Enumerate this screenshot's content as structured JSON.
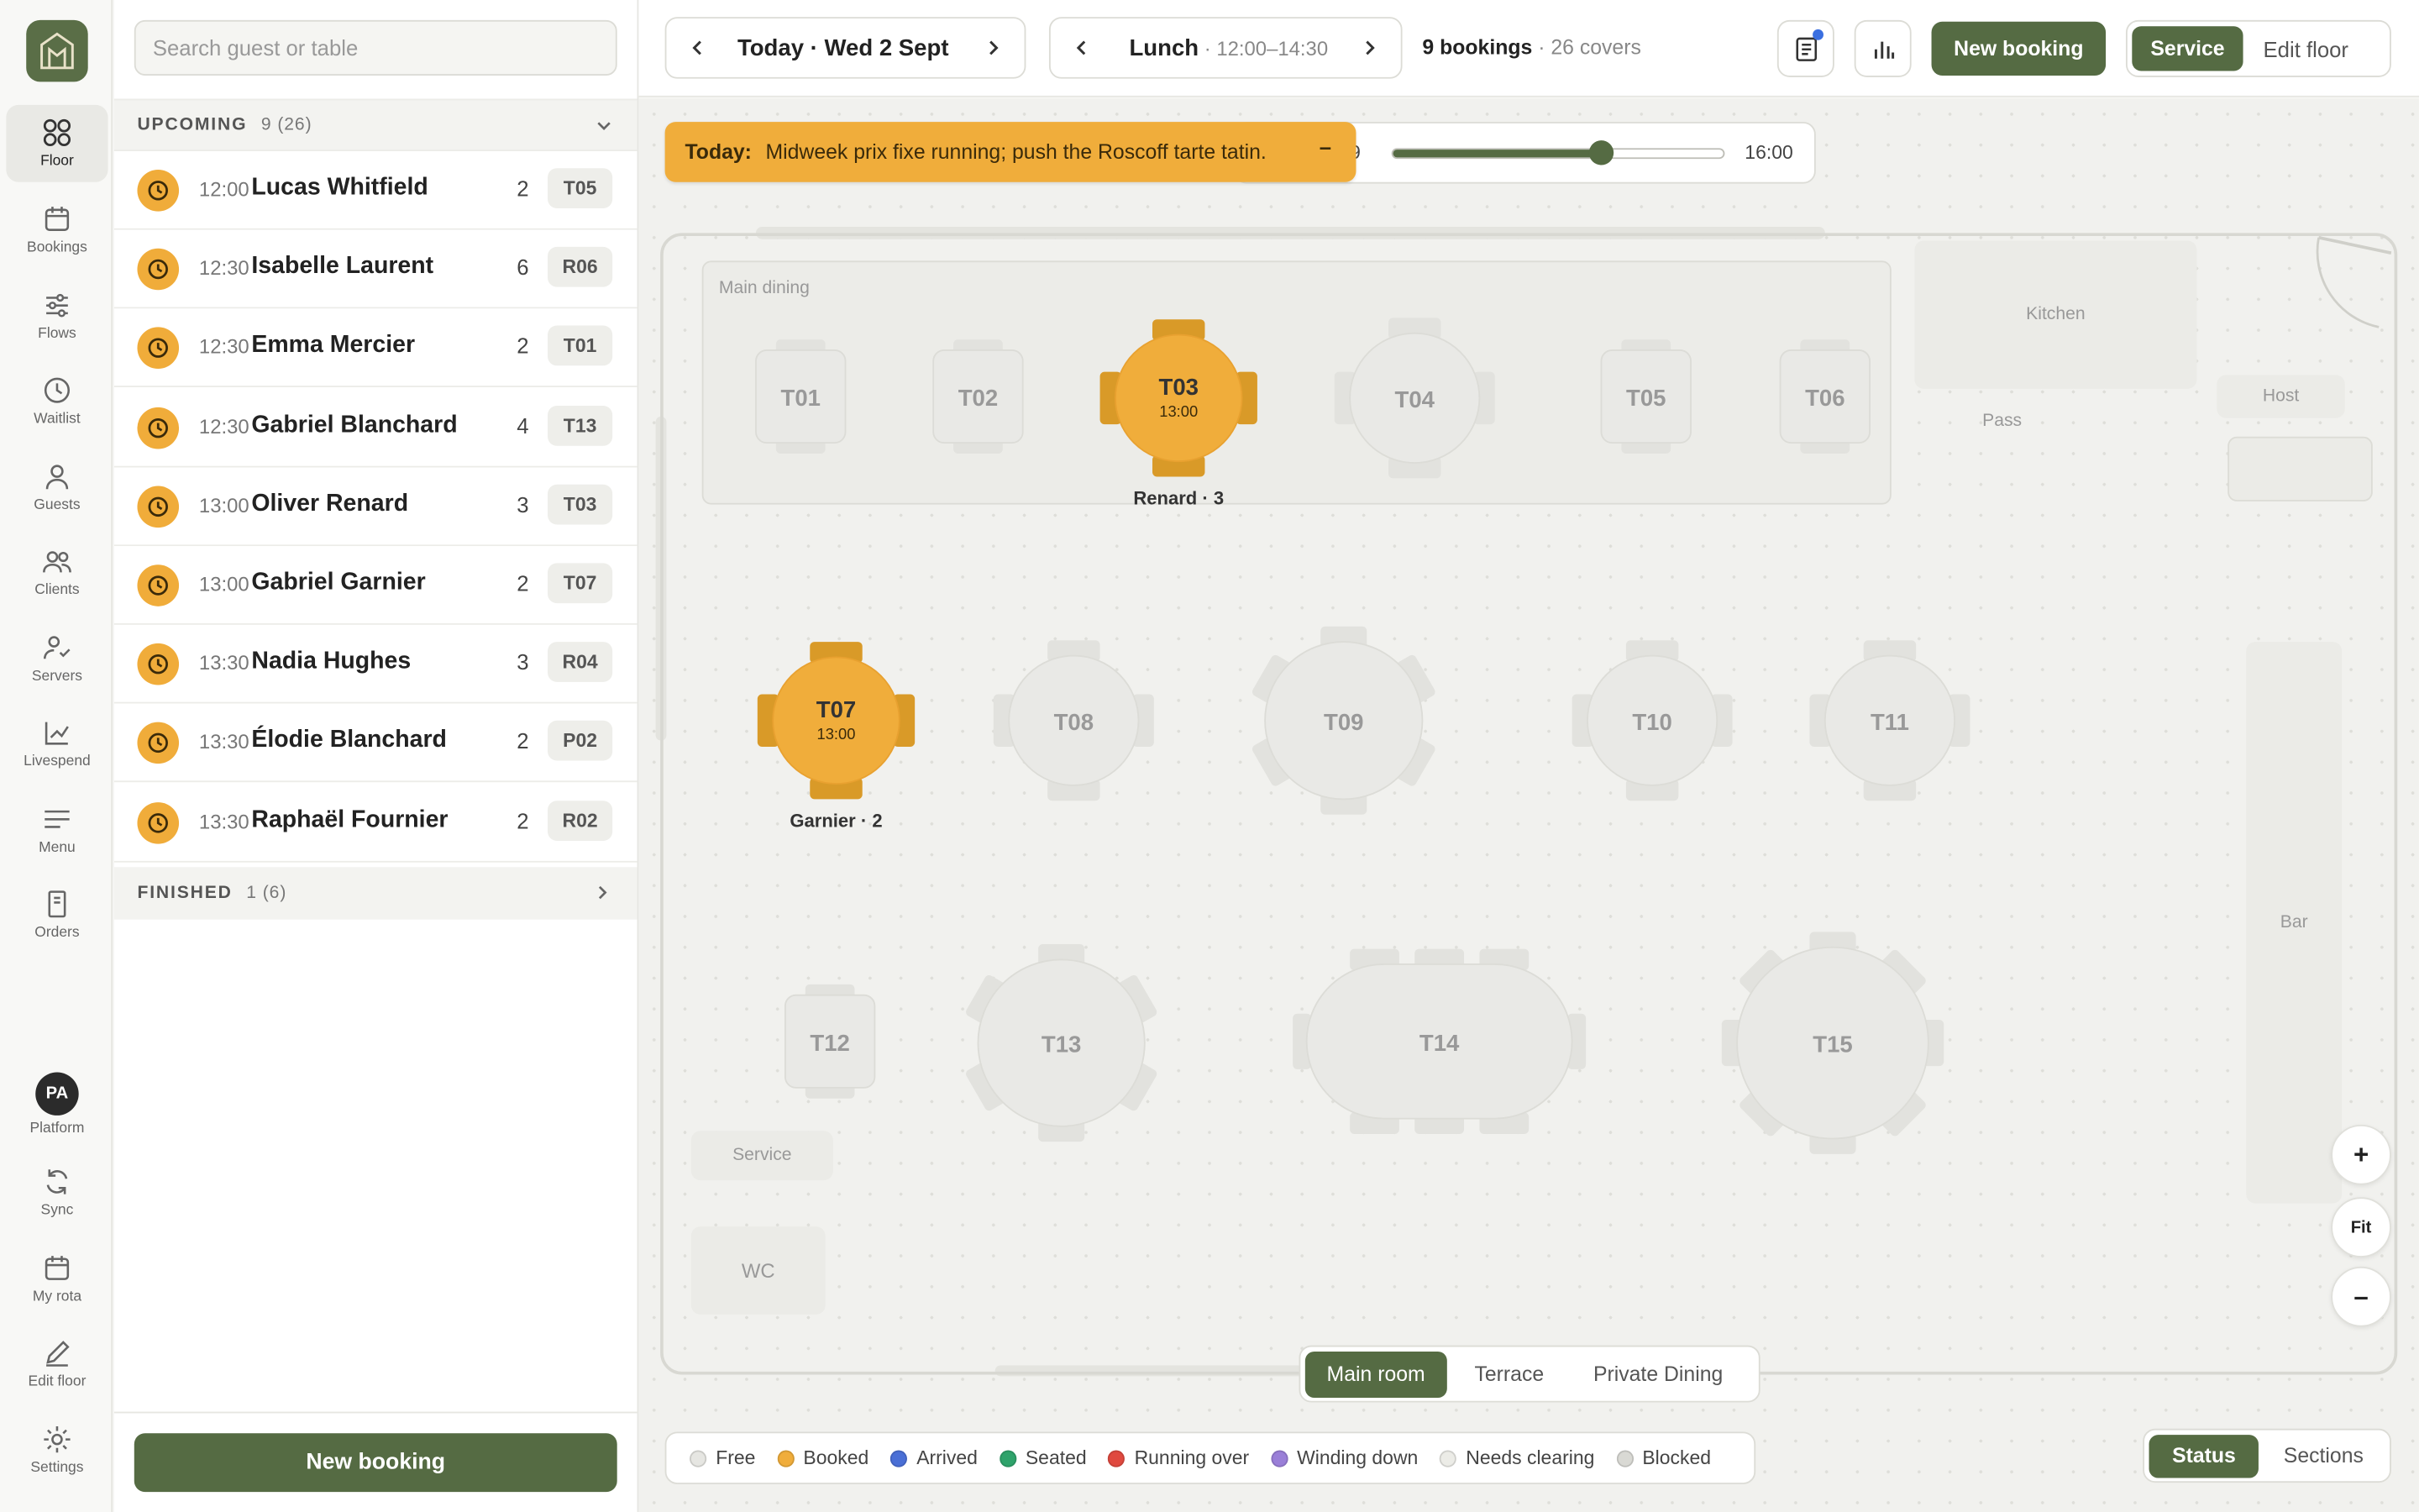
{
  "nav": {
    "items": [
      {
        "label": "Floor",
        "icon": "floor-grid-icon",
        "active": true
      },
      {
        "label": "Bookings",
        "icon": "calendar-icon"
      },
      {
        "label": "Flows",
        "icon": "sliders-icon"
      },
      {
        "label": "Waitlist",
        "icon": "clock-icon"
      },
      {
        "label": "Guests",
        "icon": "person-icon"
      },
      {
        "label": "Clients",
        "icon": "people-icon"
      },
      {
        "label": "Servers",
        "icon": "server-staff-icon"
      },
      {
        "label": "Livespend",
        "icon": "trend-chart-icon"
      },
      {
        "label": "Menu",
        "icon": "menu-lines-icon"
      },
      {
        "label": "Orders",
        "icon": "receipt-icon"
      }
    ],
    "bottom": [
      {
        "label": "Platform",
        "avatar": "PA"
      },
      {
        "label": "Sync",
        "icon": "sync-icon"
      },
      {
        "label": "My rota",
        "icon": "calendar-icon"
      },
      {
        "label": "Edit floor",
        "icon": "pencil-icon"
      },
      {
        "label": "Settings",
        "icon": "gear-icon"
      }
    ]
  },
  "search": {
    "placeholder": "Search guest or table"
  },
  "upcoming": {
    "title": "UPCOMING",
    "count": "9 (26)",
    "rows": [
      {
        "time": "12:00",
        "name": "Lucas Whitfield",
        "covers": "2",
        "table": "T05"
      },
      {
        "time": "12:30",
        "name": "Isabelle Laurent",
        "covers": "6",
        "table": "R06"
      },
      {
        "time": "12:30",
        "name": "Emma Mercier",
        "covers": "2",
        "table": "T01"
      },
      {
        "time": "12:30",
        "name": "Gabriel Blanchard",
        "covers": "4",
        "table": "T13"
      },
      {
        "time": "13:00",
        "name": "Oliver Renard",
        "covers": "3",
        "table": "T03"
      },
      {
        "time": "13:00",
        "name": "Gabriel Garnier",
        "covers": "2",
        "table": "T07"
      },
      {
        "time": "13:30",
        "name": "Nadia Hughes",
        "covers": "3",
        "table": "R04"
      },
      {
        "time": "13:30",
        "name": "Élodie Blanchard",
        "covers": "2",
        "table": "P02"
      },
      {
        "time": "13:30",
        "name": "Raphaël Fournier",
        "covers": "2",
        "table": "R02"
      }
    ]
  },
  "finished": {
    "title": "FINISHED",
    "count": "1 (6)"
  },
  "panel_button": "New booking",
  "topbar": {
    "date": "Today · Wed 2 Sept",
    "service": "Lunch",
    "service_time": " · 12:00–14:30",
    "bookings": "9 bookings",
    "covers": " · 26 covers",
    "new_booking": "New booking",
    "mode_service": "Service",
    "mode_edit": "Edit floor"
  },
  "banner": {
    "label": "Today:",
    "text": "Midweek prix fixe running; push the Roscoff tarte tatin.",
    "close": "–"
  },
  "timeline": {
    "start_partial": "9",
    "end": "16:00",
    "position": 0.63
  },
  "zones": {
    "main_dining": "Main dining",
    "kitchen": "Kitchen",
    "pass": "Pass",
    "host": "Host",
    "bar": "Bar",
    "service": "Service",
    "wc": "WC"
  },
  "tables": [
    {
      "id": "T01",
      "status": "free"
    },
    {
      "id": "T02",
      "status": "free"
    },
    {
      "id": "T03",
      "status": "booked",
      "time": "13:00",
      "guest": "Renard · 3"
    },
    {
      "id": "T04",
      "status": "free"
    },
    {
      "id": "T05",
      "status": "free"
    },
    {
      "id": "T06",
      "status": "free"
    },
    {
      "id": "T07",
      "status": "booked",
      "time": "13:00",
      "guest": "Garnier · 2"
    },
    {
      "id": "T08",
      "status": "free"
    },
    {
      "id": "T09",
      "status": "free"
    },
    {
      "id": "T10",
      "status": "free"
    },
    {
      "id": "T11",
      "status": "free"
    },
    {
      "id": "T12",
      "status": "free"
    },
    {
      "id": "T13",
      "status": "free"
    },
    {
      "id": "T14",
      "status": "free"
    },
    {
      "id": "T15",
      "status": "free"
    }
  ],
  "zoom": {
    "in": "+",
    "fit": "Fit",
    "out": "–"
  },
  "rooms": {
    "main": "Main room",
    "terrace": "Terrace",
    "private": "Private Dining"
  },
  "legend": [
    {
      "label": "Free",
      "color": "#e6e6e2"
    },
    {
      "label": "Booked",
      "color": "#f0ad3b"
    },
    {
      "label": "Arrived",
      "color": "#4a6fd6"
    },
    {
      "label": "Seated",
      "color": "#2fa36b"
    },
    {
      "label": "Running over",
      "color": "#e0493f"
    },
    {
      "label": "Winding down",
      "color": "#9a7fd8"
    },
    {
      "label": "Needs clearing",
      "color": "#ececE7"
    },
    {
      "label": "Blocked",
      "color": "#d9d9d4"
    }
  ],
  "view": {
    "status": "Status",
    "sections": "Sections"
  },
  "colors": {
    "accent": "#556b43",
    "booked": "#f0ad3b"
  }
}
